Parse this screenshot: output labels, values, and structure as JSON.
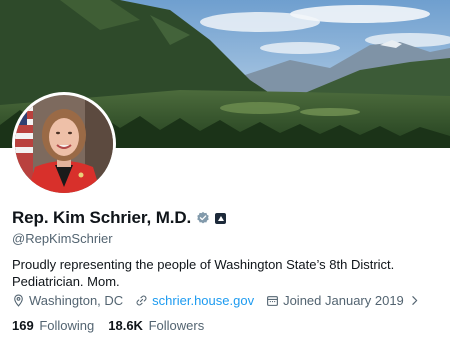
{
  "profile": {
    "name": "Rep. Kim Schrier, M.D.",
    "handle": "@RepKimSchrier",
    "bio": "Proudly representing the people of Washington State’s 8th District. Pediatrician. Mom.",
    "location": "Washington, DC",
    "website": "schrier.house.gov",
    "joined": "Joined January 2019",
    "following_count": "169",
    "following_label": "Following",
    "followers_count": "18.6K",
    "followers_label": "Followers"
  },
  "icons": {
    "verified": "verified-badge-icon",
    "government": "government-affiliation-icon",
    "location": "location-pin-icon",
    "link": "link-icon",
    "calendar": "calendar-icon",
    "chevron": "chevron-right-icon"
  },
  "colors": {
    "accent": "#1d9bf0",
    "text_primary": "#0f1419",
    "text_secondary": "#536471",
    "verified_gray": "#829aab"
  }
}
